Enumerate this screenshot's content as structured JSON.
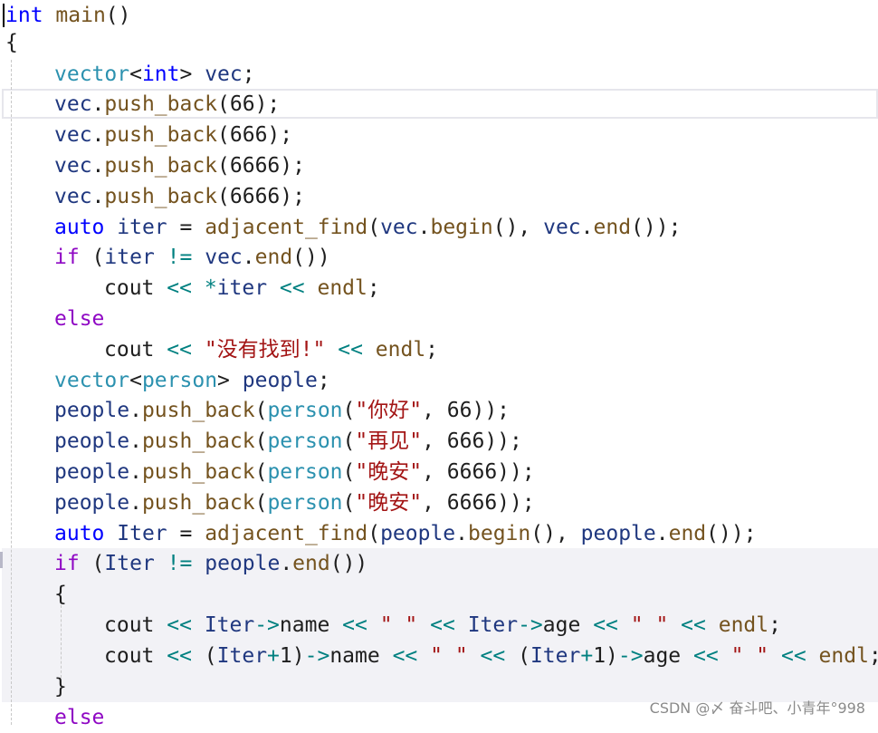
{
  "code_lines": [
    [
      {
        "t": "int",
        "c": "kw"
      },
      {
        "t": " ",
        "c": "punct"
      },
      {
        "t": "main",
        "c": "fn"
      },
      {
        "t": "()",
        "c": "punct"
      }
    ],
    [
      {
        "t": "{",
        "c": "punct"
      }
    ],
    [
      {
        "t": "vector",
        "c": "typ"
      },
      {
        "t": "<",
        "c": "punct"
      },
      {
        "t": "int",
        "c": "kw"
      },
      {
        "t": "> ",
        "c": "punct"
      },
      {
        "t": "vec",
        "c": "var"
      },
      {
        "t": ";",
        "c": "punct"
      }
    ],
    [
      {
        "t": "vec",
        "c": "var"
      },
      {
        "t": ".",
        "c": "punct"
      },
      {
        "t": "push_back",
        "c": "fn"
      },
      {
        "t": "(66);",
        "c": "punct"
      }
    ],
    [
      {
        "t": "vec",
        "c": "var"
      },
      {
        "t": ".",
        "c": "punct"
      },
      {
        "t": "push_back",
        "c": "fn"
      },
      {
        "t": "(666);",
        "c": "punct"
      }
    ],
    [
      {
        "t": "vec",
        "c": "var"
      },
      {
        "t": ".",
        "c": "punct"
      },
      {
        "t": "push_back",
        "c": "fn"
      },
      {
        "t": "(6666);",
        "c": "punct"
      }
    ],
    [
      {
        "t": "vec",
        "c": "var"
      },
      {
        "t": ".",
        "c": "punct"
      },
      {
        "t": "push_back",
        "c": "fn"
      },
      {
        "t": "(6666);",
        "c": "punct"
      }
    ],
    [
      {
        "t": "auto",
        "c": "kw"
      },
      {
        "t": " ",
        "c": "punct"
      },
      {
        "t": "iter",
        "c": "var"
      },
      {
        "t": " = ",
        "c": "punct"
      },
      {
        "t": "adjacent_find",
        "c": "fn"
      },
      {
        "t": "(",
        "c": "punct"
      },
      {
        "t": "vec",
        "c": "var"
      },
      {
        "t": ".",
        "c": "punct"
      },
      {
        "t": "begin",
        "c": "fn"
      },
      {
        "t": "(), ",
        "c": "punct"
      },
      {
        "t": "vec",
        "c": "var"
      },
      {
        "t": ".",
        "c": "punct"
      },
      {
        "t": "end",
        "c": "fn"
      },
      {
        "t": "());",
        "c": "punct"
      }
    ],
    [
      {
        "t": "if",
        "c": "ctl"
      },
      {
        "t": " (",
        "c": "punct"
      },
      {
        "t": "iter",
        "c": "var"
      },
      {
        "t": " ",
        "c": "punct"
      },
      {
        "t": "!=",
        "c": "op"
      },
      {
        "t": " ",
        "c": "punct"
      },
      {
        "t": "vec",
        "c": "var"
      },
      {
        "t": ".",
        "c": "punct"
      },
      {
        "t": "end",
        "c": "fn"
      },
      {
        "t": "())",
        "c": "punct"
      }
    ],
    [
      {
        "t": "cout",
        "c": "obj"
      },
      {
        "t": " ",
        "c": "punct"
      },
      {
        "t": "<<",
        "c": "op"
      },
      {
        "t": " ",
        "c": "punct"
      },
      {
        "t": "*",
        "c": "op"
      },
      {
        "t": "iter",
        "c": "var"
      },
      {
        "t": " ",
        "c": "punct"
      },
      {
        "t": "<<",
        "c": "op"
      },
      {
        "t": " ",
        "c": "punct"
      },
      {
        "t": "endl",
        "c": "fn"
      },
      {
        "t": ";",
        "c": "punct"
      }
    ],
    [
      {
        "t": "else",
        "c": "ctl"
      }
    ],
    [
      {
        "t": "cout",
        "c": "obj"
      },
      {
        "t": " ",
        "c": "punct"
      },
      {
        "t": "<<",
        "c": "op"
      },
      {
        "t": " ",
        "c": "punct"
      },
      {
        "t": "\"没有找到!\"",
        "c": "str"
      },
      {
        "t": " ",
        "c": "punct"
      },
      {
        "t": "<<",
        "c": "op"
      },
      {
        "t": " ",
        "c": "punct"
      },
      {
        "t": "endl",
        "c": "fn"
      },
      {
        "t": ";",
        "c": "punct"
      }
    ],
    [
      {
        "t": "vector",
        "c": "typ"
      },
      {
        "t": "<",
        "c": "punct"
      },
      {
        "t": "person",
        "c": "typ"
      },
      {
        "t": "> ",
        "c": "punct"
      },
      {
        "t": "people",
        "c": "var"
      },
      {
        "t": ";",
        "c": "punct"
      }
    ],
    [
      {
        "t": "people",
        "c": "var"
      },
      {
        "t": ".",
        "c": "punct"
      },
      {
        "t": "push_back",
        "c": "fn"
      },
      {
        "t": "(",
        "c": "punct"
      },
      {
        "t": "person",
        "c": "typ"
      },
      {
        "t": "(",
        "c": "punct"
      },
      {
        "t": "\"你好\"",
        "c": "str"
      },
      {
        "t": ", 66));",
        "c": "punct"
      }
    ],
    [
      {
        "t": "people",
        "c": "var"
      },
      {
        "t": ".",
        "c": "punct"
      },
      {
        "t": "push_back",
        "c": "fn"
      },
      {
        "t": "(",
        "c": "punct"
      },
      {
        "t": "person",
        "c": "typ"
      },
      {
        "t": "(",
        "c": "punct"
      },
      {
        "t": "\"再见\"",
        "c": "str"
      },
      {
        "t": ", 666));",
        "c": "punct"
      }
    ],
    [
      {
        "t": "people",
        "c": "var"
      },
      {
        "t": ".",
        "c": "punct"
      },
      {
        "t": "push_back",
        "c": "fn"
      },
      {
        "t": "(",
        "c": "punct"
      },
      {
        "t": "person",
        "c": "typ"
      },
      {
        "t": "(",
        "c": "punct"
      },
      {
        "t": "\"晚安\"",
        "c": "str"
      },
      {
        "t": ", 6666));",
        "c": "punct"
      }
    ],
    [
      {
        "t": "people",
        "c": "var"
      },
      {
        "t": ".",
        "c": "punct"
      },
      {
        "t": "push_back",
        "c": "fn"
      },
      {
        "t": "(",
        "c": "punct"
      },
      {
        "t": "person",
        "c": "typ"
      },
      {
        "t": "(",
        "c": "punct"
      },
      {
        "t": "\"晚安\"",
        "c": "str"
      },
      {
        "t": ", 6666));",
        "c": "punct"
      }
    ],
    [
      {
        "t": "auto",
        "c": "kw"
      },
      {
        "t": " ",
        "c": "punct"
      },
      {
        "t": "Iter",
        "c": "var"
      },
      {
        "t": " = ",
        "c": "punct"
      },
      {
        "t": "adjacent_find",
        "c": "fn"
      },
      {
        "t": "(",
        "c": "punct"
      },
      {
        "t": "people",
        "c": "var"
      },
      {
        "t": ".",
        "c": "punct"
      },
      {
        "t": "begin",
        "c": "fn"
      },
      {
        "t": "(), ",
        "c": "punct"
      },
      {
        "t": "people",
        "c": "var"
      },
      {
        "t": ".",
        "c": "punct"
      },
      {
        "t": "end",
        "c": "fn"
      },
      {
        "t": "());",
        "c": "punct"
      }
    ],
    [
      {
        "t": "if",
        "c": "ctl"
      },
      {
        "t": " (",
        "c": "punct"
      },
      {
        "t": "Iter",
        "c": "var"
      },
      {
        "t": " ",
        "c": "punct"
      },
      {
        "t": "!=",
        "c": "op"
      },
      {
        "t": " ",
        "c": "punct"
      },
      {
        "t": "people",
        "c": "var"
      },
      {
        "t": ".",
        "c": "punct"
      },
      {
        "t": "end",
        "c": "fn"
      },
      {
        "t": "())",
        "c": "punct"
      }
    ],
    [
      {
        "t": "{",
        "c": "punct"
      }
    ],
    [
      {
        "t": "cout",
        "c": "obj"
      },
      {
        "t": " ",
        "c": "punct"
      },
      {
        "t": "<<",
        "c": "op"
      },
      {
        "t": " ",
        "c": "punct"
      },
      {
        "t": "Iter",
        "c": "var"
      },
      {
        "t": "->",
        "c": "op"
      },
      {
        "t": "name",
        "c": "mem"
      },
      {
        "t": " ",
        "c": "punct"
      },
      {
        "t": "<<",
        "c": "op"
      },
      {
        "t": " ",
        "c": "punct"
      },
      {
        "t": "\" \"",
        "c": "str"
      },
      {
        "t": " ",
        "c": "punct"
      },
      {
        "t": "<<",
        "c": "op"
      },
      {
        "t": " ",
        "c": "punct"
      },
      {
        "t": "Iter",
        "c": "var"
      },
      {
        "t": "->",
        "c": "op"
      },
      {
        "t": "age",
        "c": "mem"
      },
      {
        "t": " ",
        "c": "punct"
      },
      {
        "t": "<<",
        "c": "op"
      },
      {
        "t": " ",
        "c": "punct"
      },
      {
        "t": "\" \"",
        "c": "str"
      },
      {
        "t": " ",
        "c": "punct"
      },
      {
        "t": "<<",
        "c": "op"
      },
      {
        "t": " ",
        "c": "punct"
      },
      {
        "t": "endl",
        "c": "fn"
      },
      {
        "t": ";",
        "c": "punct"
      }
    ],
    [
      {
        "t": "cout",
        "c": "obj"
      },
      {
        "t": " ",
        "c": "punct"
      },
      {
        "t": "<<",
        "c": "op"
      },
      {
        "t": " (",
        "c": "punct"
      },
      {
        "t": "Iter",
        "c": "var"
      },
      {
        "t": "+",
        "c": "op"
      },
      {
        "t": "1)",
        "c": "punct"
      },
      {
        "t": "->",
        "c": "op"
      },
      {
        "t": "name",
        "c": "mem"
      },
      {
        "t": " ",
        "c": "punct"
      },
      {
        "t": "<<",
        "c": "op"
      },
      {
        "t": " ",
        "c": "punct"
      },
      {
        "t": "\" \"",
        "c": "str"
      },
      {
        "t": " ",
        "c": "punct"
      },
      {
        "t": "<<",
        "c": "op"
      },
      {
        "t": " (",
        "c": "punct"
      },
      {
        "t": "Iter",
        "c": "var"
      },
      {
        "t": "+",
        "c": "op"
      },
      {
        "t": "1)",
        "c": "punct"
      },
      {
        "t": "->",
        "c": "op"
      },
      {
        "t": "age",
        "c": "mem"
      },
      {
        "t": " ",
        "c": "punct"
      },
      {
        "t": "<<",
        "c": "op"
      },
      {
        "t": " ",
        "c": "punct"
      },
      {
        "t": "\" \"",
        "c": "str"
      },
      {
        "t": " ",
        "c": "punct"
      },
      {
        "t": "<<",
        "c": "op"
      },
      {
        "t": " ",
        "c": "punct"
      },
      {
        "t": "endl",
        "c": "fn"
      },
      {
        "t": ";",
        "c": "punct"
      }
    ],
    [
      {
        "t": "}",
        "c": "punct"
      }
    ],
    [
      {
        "t": "else",
        "c": "ctl"
      }
    ]
  ],
  "watermark": "CSDN @〆 奋斗吧、小青年°998"
}
